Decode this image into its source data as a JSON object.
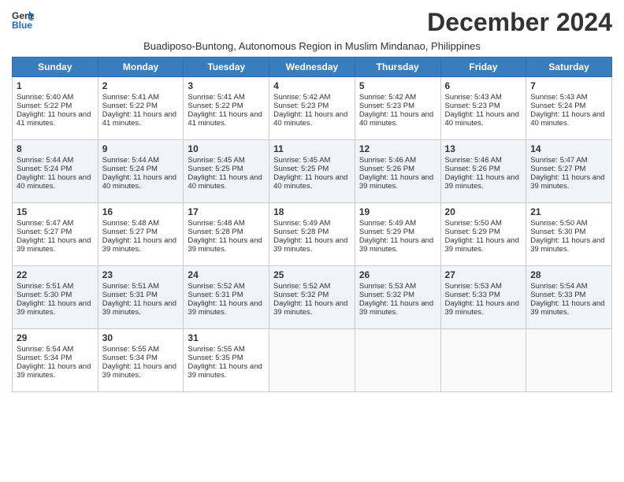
{
  "header": {
    "logo_general": "General",
    "logo_blue": "Blue",
    "month_title": "December 2024",
    "subtitle": "Buadiposo-Buntong, Autonomous Region in Muslim Mindanao, Philippines"
  },
  "weekdays": [
    "Sunday",
    "Monday",
    "Tuesday",
    "Wednesday",
    "Thursday",
    "Friday",
    "Saturday"
  ],
  "weeks": [
    [
      {
        "day": "1",
        "sunrise": "5:40 AM",
        "sunset": "5:22 PM",
        "daylight": "11 hours and 41 minutes"
      },
      {
        "day": "2",
        "sunrise": "5:41 AM",
        "sunset": "5:22 PM",
        "daylight": "11 hours and 41 minutes"
      },
      {
        "day": "3",
        "sunrise": "5:41 AM",
        "sunset": "5:22 PM",
        "daylight": "11 hours and 41 minutes"
      },
      {
        "day": "4",
        "sunrise": "5:42 AM",
        "sunset": "5:23 PM",
        "daylight": "11 hours and 40 minutes"
      },
      {
        "day": "5",
        "sunrise": "5:42 AM",
        "sunset": "5:23 PM",
        "daylight": "11 hours and 40 minutes"
      },
      {
        "day": "6",
        "sunrise": "5:43 AM",
        "sunset": "5:23 PM",
        "daylight": "11 hours and 40 minutes"
      },
      {
        "day": "7",
        "sunrise": "5:43 AM",
        "sunset": "5:24 PM",
        "daylight": "11 hours and 40 minutes"
      }
    ],
    [
      {
        "day": "8",
        "sunrise": "5:44 AM",
        "sunset": "5:24 PM",
        "daylight": "11 hours and 40 minutes"
      },
      {
        "day": "9",
        "sunrise": "5:44 AM",
        "sunset": "5:24 PM",
        "daylight": "11 hours and 40 minutes"
      },
      {
        "day": "10",
        "sunrise": "5:45 AM",
        "sunset": "5:25 PM",
        "daylight": "11 hours and 40 minutes"
      },
      {
        "day": "11",
        "sunrise": "5:45 AM",
        "sunset": "5:25 PM",
        "daylight": "11 hours and 40 minutes"
      },
      {
        "day": "12",
        "sunrise": "5:46 AM",
        "sunset": "5:26 PM",
        "daylight": "11 hours and 39 minutes"
      },
      {
        "day": "13",
        "sunrise": "5:46 AM",
        "sunset": "5:26 PM",
        "daylight": "11 hours and 39 minutes"
      },
      {
        "day": "14",
        "sunrise": "5:47 AM",
        "sunset": "5:27 PM",
        "daylight": "11 hours and 39 minutes"
      }
    ],
    [
      {
        "day": "15",
        "sunrise": "5:47 AM",
        "sunset": "5:27 PM",
        "daylight": "11 hours and 39 minutes"
      },
      {
        "day": "16",
        "sunrise": "5:48 AM",
        "sunset": "5:27 PM",
        "daylight": "11 hours and 39 minutes"
      },
      {
        "day": "17",
        "sunrise": "5:48 AM",
        "sunset": "5:28 PM",
        "daylight": "11 hours and 39 minutes"
      },
      {
        "day": "18",
        "sunrise": "5:49 AM",
        "sunset": "5:28 PM",
        "daylight": "11 hours and 39 minutes"
      },
      {
        "day": "19",
        "sunrise": "5:49 AM",
        "sunset": "5:29 PM",
        "daylight": "11 hours and 39 minutes"
      },
      {
        "day": "20",
        "sunrise": "5:50 AM",
        "sunset": "5:29 PM",
        "daylight": "11 hours and 39 minutes"
      },
      {
        "day": "21",
        "sunrise": "5:50 AM",
        "sunset": "5:30 PM",
        "daylight": "11 hours and 39 minutes"
      }
    ],
    [
      {
        "day": "22",
        "sunrise": "5:51 AM",
        "sunset": "5:30 PM",
        "daylight": "11 hours and 39 minutes"
      },
      {
        "day": "23",
        "sunrise": "5:51 AM",
        "sunset": "5:31 PM",
        "daylight": "11 hours and 39 minutes"
      },
      {
        "day": "24",
        "sunrise": "5:52 AM",
        "sunset": "5:31 PM",
        "daylight": "11 hours and 39 minutes"
      },
      {
        "day": "25",
        "sunrise": "5:52 AM",
        "sunset": "5:32 PM",
        "daylight": "11 hours and 39 minutes"
      },
      {
        "day": "26",
        "sunrise": "5:53 AM",
        "sunset": "5:32 PM",
        "daylight": "11 hours and 39 minutes"
      },
      {
        "day": "27",
        "sunrise": "5:53 AM",
        "sunset": "5:33 PM",
        "daylight": "11 hours and 39 minutes"
      },
      {
        "day": "28",
        "sunrise": "5:54 AM",
        "sunset": "5:33 PM",
        "daylight": "11 hours and 39 minutes"
      }
    ],
    [
      {
        "day": "29",
        "sunrise": "5:54 AM",
        "sunset": "5:34 PM",
        "daylight": "11 hours and 39 minutes"
      },
      {
        "day": "30",
        "sunrise": "5:55 AM",
        "sunset": "5:34 PM",
        "daylight": "11 hours and 39 minutes"
      },
      {
        "day": "31",
        "sunrise": "5:55 AM",
        "sunset": "5:35 PM",
        "daylight": "11 hours and 39 minutes"
      },
      null,
      null,
      null,
      null
    ]
  ],
  "labels": {
    "sunrise": "Sunrise:",
    "sunset": "Sunset:",
    "daylight": "Daylight:"
  }
}
